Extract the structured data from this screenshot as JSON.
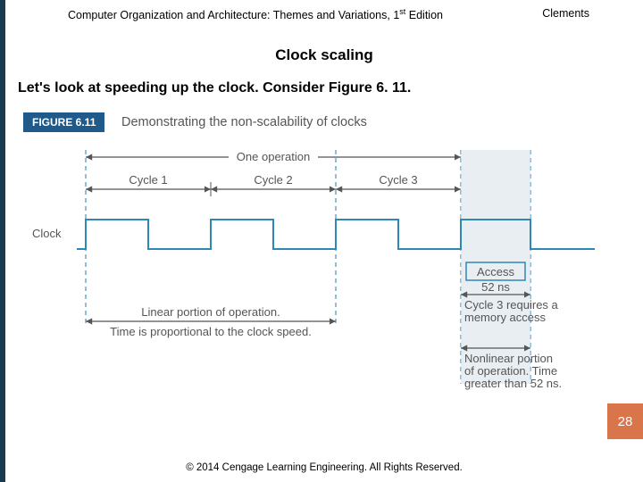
{
  "header": {
    "book": "Computer Organization and Architecture: Themes and Variations, 1",
    "edition_sup": "st",
    "edition_tail": " Edition",
    "author": "Clements"
  },
  "title": "Clock scaling",
  "body_line": "Let's look at speeding up the clock. Consider Figure 6. 11.",
  "figure": {
    "badge": "FIGURE 6.11",
    "caption": "Demonstrating the non-scalability of clocks",
    "one_op": "One operation",
    "cycle1": "Cycle 1",
    "cycle2": "Cycle 2",
    "cycle3": "Cycle 3",
    "clock_label": "Clock",
    "access": "Access",
    "t52": "52 ns",
    "c3_note1": "Cycle 3 requires a",
    "c3_note2": "memory access",
    "linear1": "Linear portion of operation.",
    "linear2": "Time is proportional to the clock speed.",
    "nonlin1": "Nonlinear portion",
    "nonlin2": "of operation. Time",
    "nonlin3": "greater than 52 ns."
  },
  "footer": "© 2014 Cengage Learning Engineering. All Rights Reserved.",
  "page_number": "28"
}
